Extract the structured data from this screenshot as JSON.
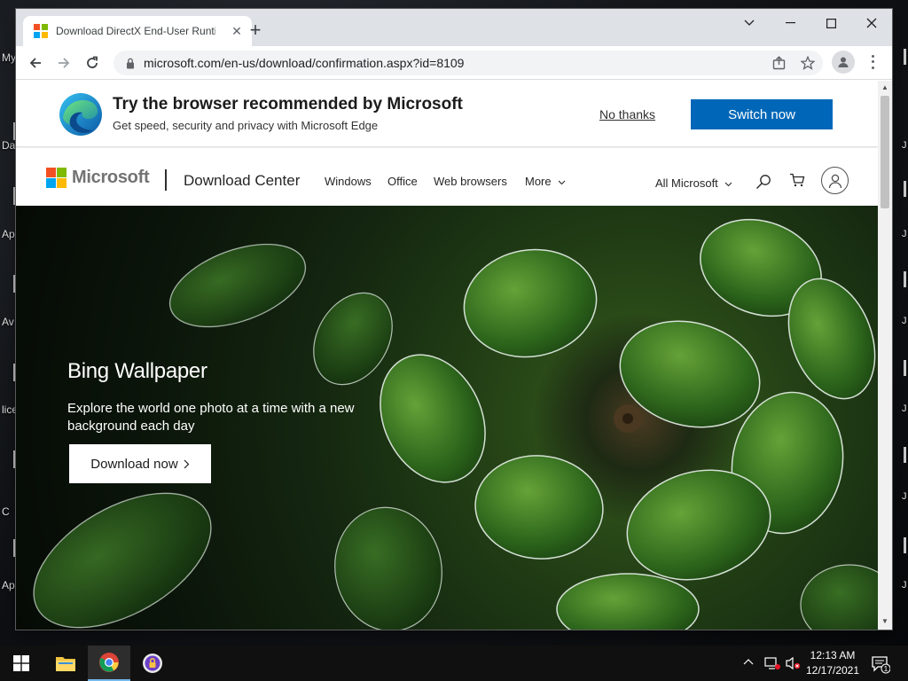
{
  "desktop": {
    "icons": [
      {
        "label": "My"
      },
      {
        "label": "Da"
      },
      {
        "label": "Ap"
      },
      {
        "label": "Av"
      },
      {
        "label": "lice"
      },
      {
        "label": "C"
      },
      {
        "label": "Ap"
      }
    ]
  },
  "browser": {
    "tab_title": "Download DirectX End-User Runtime",
    "url": "microsoft.com/en-us/download/confirmation.aspx?id=8109"
  },
  "edge_banner": {
    "title": "Try the browser recommended by Microsoft",
    "subtitle": "Get speed, security and privacy with Microsoft Edge",
    "no_thanks": "No thanks",
    "switch_now": "Switch now"
  },
  "header": {
    "logo_text": "Microsoft",
    "site_title": "Download Center",
    "nav": [
      "Windows",
      "Office",
      "Web browsers",
      "More"
    ],
    "all_microsoft": "All Microsoft"
  },
  "hero": {
    "title": "Bing Wallpaper",
    "description": "Explore the world one photo at a time with a new background each day",
    "button": "Download now"
  },
  "taskbar": {
    "time": "12:13 AM",
    "date": "12/17/2021",
    "notification_count": "1"
  },
  "colors": {
    "accent": "#0067b8",
    "ms_red": "#f25022",
    "ms_green": "#7fba00",
    "ms_blue": "#00a4ef",
    "ms_yellow": "#ffb900"
  }
}
